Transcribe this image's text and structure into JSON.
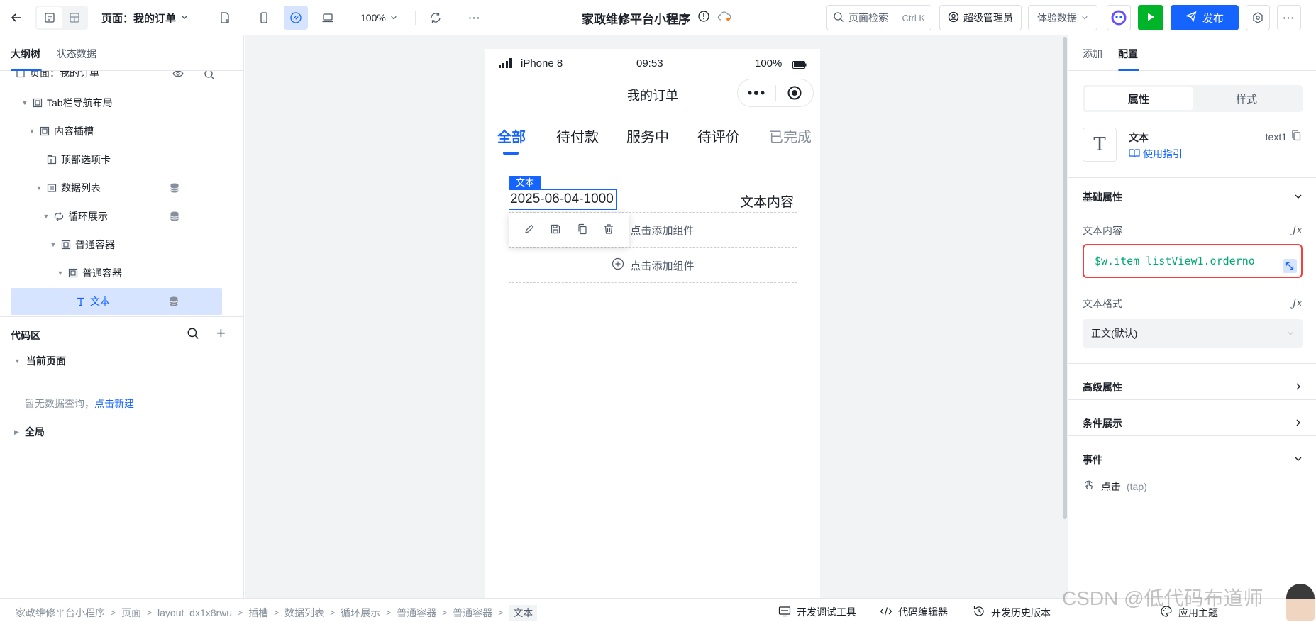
{
  "toolbar": {
    "page_label": "页面：我的订单",
    "zoom": "100%",
    "app_title": "家政维修平台小程序",
    "search_placeholder": "页面检索",
    "search_shortcut": "Ctrl K",
    "role": "超级管理员",
    "data_mode": "体验数据",
    "publish": "发布"
  },
  "left": {
    "tabs": [
      "大纲树",
      "状态数据"
    ],
    "tree": [
      {
        "label": "页面：我的订单"
      },
      {
        "label": "Tab栏导航布局"
      },
      {
        "label": "内容插槽"
      },
      {
        "label": "顶部选项卡"
      },
      {
        "label": "数据列表"
      },
      {
        "label": "循环展示"
      },
      {
        "label": "普通容器"
      },
      {
        "label": "普通容器"
      },
      {
        "label": "文本"
      }
    ],
    "code": {
      "title": "代码区",
      "current_page": "当前页面",
      "empty_text": "暂无数据查询，",
      "empty_link": "点击新建",
      "global": "全局"
    }
  },
  "phone": {
    "carrier": "iPhone 8",
    "time": "09:53",
    "battery": "100%",
    "nav_title": "我的订单",
    "tabs": [
      "全部",
      "待付款",
      "服务中",
      "待评价",
      "已完成"
    ],
    "selected_label": "文本",
    "selected_text": "2025-06-04-1000",
    "right_text": "文本内容",
    "add_component": "点击添加组件"
  },
  "right": {
    "tabs": [
      "添加",
      "配置"
    ],
    "segments": [
      "属性",
      "样式"
    ],
    "component": {
      "icon_glyph": "T",
      "name": "文本",
      "guide": "使用指引",
      "id": "text1"
    },
    "basic_props": "基础属性",
    "text_content_label": "文本内容",
    "text_content_expr": "$w.item_listView1.orderno",
    "text_format_label": "文本格式",
    "text_format_value": "正文(默认)",
    "advanced_props": "高级属性",
    "conditional": "条件展示",
    "events": "事件",
    "event_click": "点击",
    "event_click_hint": "(tap)"
  },
  "bottom": {
    "breadcrumbs": [
      "家政维修平台小程序",
      "页面",
      "layout_dx1x8rwu",
      "插槽",
      "数据列表",
      "循环展示",
      "普通容器",
      "普通容器",
      "文本"
    ],
    "dev_tools": "开发调试工具",
    "code_editor": "代码编辑器",
    "history": "开发历史版本",
    "theme": "应用主题"
  },
  "watermark": "CSDN @低代码布道师",
  "colors": {
    "primary": "#1664ff",
    "run": "#00b42a",
    "error_border": "#f53f3f",
    "expr_text": "#00a870"
  }
}
